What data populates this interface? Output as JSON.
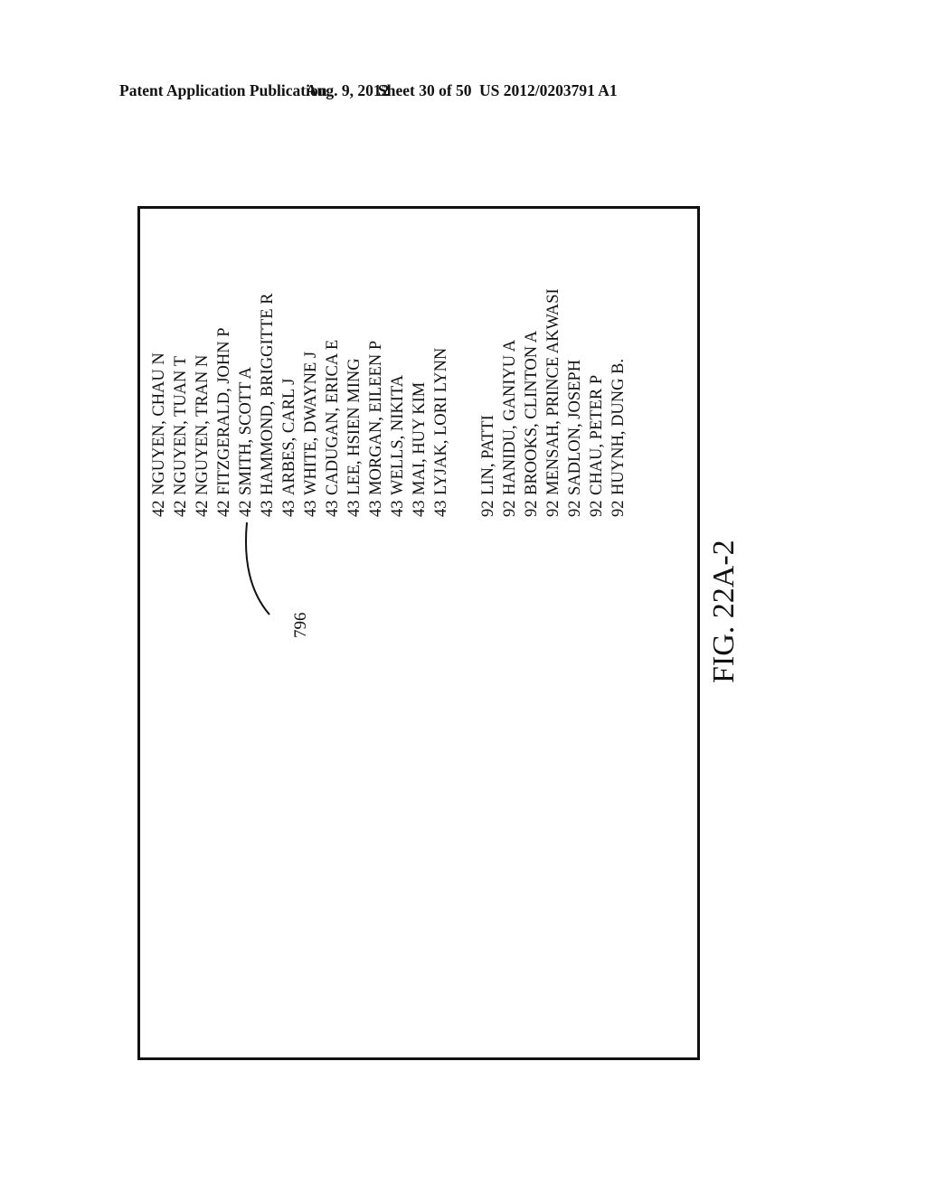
{
  "header": {
    "publication": "Patent Application Publication",
    "date": "Aug. 9, 2012",
    "sheet": "Sheet 30 of 50",
    "number": "US 2012/0203791 A1"
  },
  "figure": {
    "label": "FIG. 22A-2",
    "reference_numeral": "796",
    "group_a": [
      {
        "code": "42",
        "name": "NGUYEN, CHAU N"
      },
      {
        "code": "42",
        "name": "NGUYEN, TUAN T"
      },
      {
        "code": "42",
        "name": "NGUYEN, TRAN N"
      },
      {
        "code": "42",
        "name": "FITZGERALD, JOHN P"
      },
      {
        "code": "42",
        "name": "SMITH, SCOTT A"
      },
      {
        "code": "43",
        "name": "HAMMOND, BRIGGITTE R"
      },
      {
        "code": "43",
        "name": "ARBES, CARL J"
      },
      {
        "code": "43",
        "name": "WHITE, DWAYNE J"
      },
      {
        "code": "43",
        "name": "CADUGAN, ERICA E"
      },
      {
        "code": "43",
        "name": "LEE, HSIEN MING"
      },
      {
        "code": "43",
        "name": "MORGAN, EILEEN P"
      },
      {
        "code": "43",
        "name": "WELLS, NIKITA"
      },
      {
        "code": "43",
        "name": "MAI, HUY KIM"
      },
      {
        "code": "43",
        "name": "LYJAK, LORI LYNN"
      }
    ],
    "group_b": [
      {
        "code": "92",
        "name": "LIN, PATTI"
      },
      {
        "code": "92",
        "name": "HANIDU, GANIYU A"
      },
      {
        "code": "92",
        "name": "BROOKS, CLINTON A"
      },
      {
        "code": "92",
        "name": "MENSAH, PRINCE AKWASI"
      },
      {
        "code": "92",
        "name": "SADLON, JOSEPH"
      },
      {
        "code": "92",
        "name": "CHAU, PETER P"
      },
      {
        "code": "92",
        "name": "HUYNH, DUNG B."
      }
    ]
  }
}
